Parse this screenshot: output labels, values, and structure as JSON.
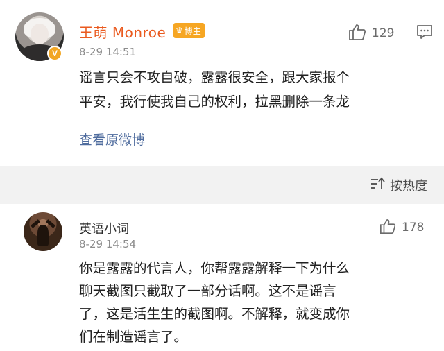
{
  "top_comment": {
    "username": "王萌 Monroe",
    "badge_label": "博主",
    "verified_mark": "V",
    "timestamp": "8-29 14:51",
    "like_count": "129",
    "body_lines": [
      "谣言只会不攻自破，露露很安全，跟大家报个",
      "平安，我行使我自己的权利，拉黑删除一条龙"
    ],
    "view_original_label": "查看原微博",
    "icons": [
      "thumbs-up-icon",
      "comment-reply-icon",
      "verified-v-icon",
      "crown-icon"
    ]
  },
  "sort_bar": {
    "label": "按热度",
    "icon": "sort-icon"
  },
  "comment_2": {
    "username": "英语小词",
    "timestamp": "8-29 14:54",
    "like_count": "178",
    "body_lines": [
      "你是露露的代言人，你帮露露解释一下为什么",
      "聊天截图只截取了一部分话啊。这不是谣言",
      "了，这是活生生的截图啊。不解释，就变成你",
      "们在制造谣言了。"
    ]
  },
  "colors": {
    "username_orange": "#ea5a1f",
    "badge_orange": "#f6a623",
    "link_blue": "#4f6c9e",
    "timestamp_gray": "#8c8c8c",
    "sortbar_bg": "#f2f2f2"
  }
}
